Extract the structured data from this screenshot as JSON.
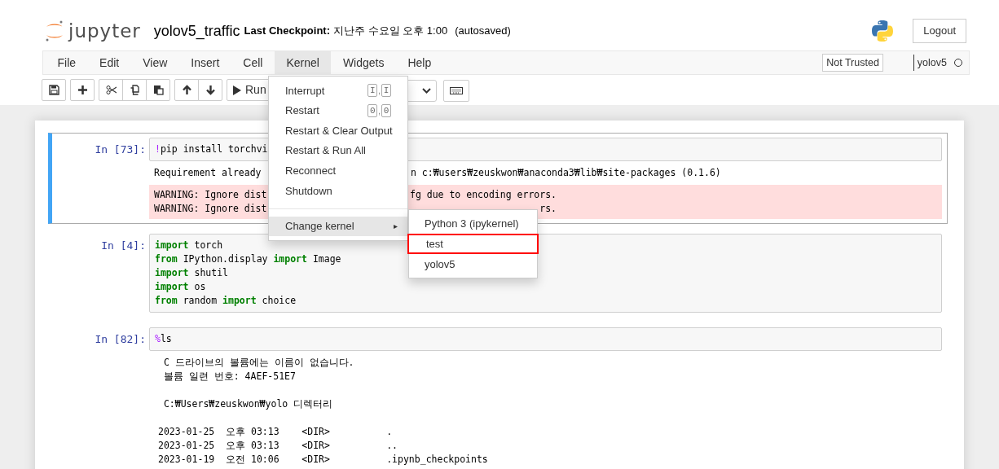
{
  "header": {
    "logo_text": "jupyter",
    "notebook_name": "yolov5_traffic",
    "checkpoint_label": "Last Checkpoint:",
    "checkpoint_time": "지난주 수요일 오후 1:00",
    "autosave": "(autosaved)",
    "logout": "Logout"
  },
  "menubar": {
    "items": [
      {
        "label": "File",
        "selected": false
      },
      {
        "label": "Edit",
        "selected": false
      },
      {
        "label": "View",
        "selected": false
      },
      {
        "label": "Insert",
        "selected": false
      },
      {
        "label": "Cell",
        "selected": false
      },
      {
        "label": "Kernel",
        "selected": true
      },
      {
        "label": "Widgets",
        "selected": false
      },
      {
        "label": "Help",
        "selected": false
      }
    ],
    "trust": "Not Trusted",
    "kernel_name": "yolov5"
  },
  "toolbar": {
    "groups": [
      [
        {
          "kind": "save"
        }
      ],
      [
        {
          "kind": "add"
        }
      ],
      [
        {
          "kind": "cut"
        },
        {
          "kind": "copy"
        },
        {
          "kind": "paste"
        }
      ],
      [
        {
          "kind": "up"
        },
        {
          "kind": "down"
        }
      ],
      [
        {
          "kind": "run"
        }
      ]
    ],
    "run_label": "Run"
  },
  "kernel_menu": {
    "items": [
      {
        "kind": "item",
        "label": "Interrupt",
        "shortcut": {
          "keys": [
            "I",
            "I"
          ],
          "separator": ","
        },
        "selected": false
      },
      {
        "kind": "item",
        "label": "Restart",
        "shortcut": {
          "keys": [
            "0",
            "0"
          ],
          "separator": ","
        },
        "selected": false
      },
      {
        "kind": "item",
        "label": "Restart & Clear Output",
        "selected": false
      },
      {
        "kind": "item",
        "label": "Restart & Run All",
        "selected": false
      },
      {
        "kind": "item",
        "label": "Reconnect",
        "selected": false
      },
      {
        "kind": "item",
        "label": "Shutdown",
        "selected": false
      },
      {
        "kind": "divider"
      },
      {
        "kind": "submenu",
        "label": "Change kernel",
        "arrow": "▸",
        "selected": true
      }
    ],
    "submenu": [
      {
        "label": "Python 3 (ipykernel)",
        "outlined": false
      },
      {
        "label": "test",
        "outlined": true
      },
      {
        "label": "yolov5",
        "outlined": false
      }
    ]
  },
  "cells": [
    {
      "prompt": "In [73]:",
      "selected": true,
      "input": [
        [
          {
            "kind": "magic",
            "t": "!"
          },
          {
            "kind": "plain",
            "t": "pip install torchvi"
          }
        ]
      ],
      "outputs": [
        {
          "kind": "stream",
          "lines": [
            {
              "left": "Requirement already",
              "right": "n c:₩users₩zeuskwon₩anaconda3₩lib₩site-packages (0.1.6)"
            }
          ]
        },
        {
          "kind": "stderr",
          "lines": [
            {
              "left": "WARNING: Ignore dist",
              "right": "fg due to encoding errors."
            },
            {
              "left": "WARNING: Ignore dist",
              "right": "rs."
            }
          ]
        }
      ]
    },
    {
      "prompt": "In [4]:",
      "selected": false,
      "input": [
        [
          {
            "kind": "keyword",
            "t": "import"
          },
          {
            "kind": "plain",
            "t": " torch"
          }
        ],
        [
          {
            "kind": "keyword",
            "t": "from"
          },
          {
            "kind": "plain",
            "t": " IPython.display "
          },
          {
            "kind": "keyword",
            "t": "import"
          },
          {
            "kind": "plain",
            "t": " Image"
          }
        ],
        [
          {
            "kind": "keyword",
            "t": "import"
          },
          {
            "kind": "plain",
            "t": " shutil"
          }
        ],
        [
          {
            "kind": "keyword",
            "t": "import"
          },
          {
            "kind": "plain",
            "t": " os"
          }
        ],
        [
          {
            "kind": "keyword",
            "t": "from"
          },
          {
            "kind": "plain",
            "t": " random "
          },
          {
            "kind": "keyword",
            "t": "import"
          },
          {
            "kind": "plain",
            "t": " choice"
          }
        ]
      ]
    },
    {
      "prompt": "In [82]:",
      "selected": false,
      "input": [
        [
          {
            "kind": "magic",
            "t": "%"
          },
          {
            "kind": "plain",
            "t": "ls"
          }
        ]
      ],
      "outputs": [
        {
          "kind": "text",
          "paragraphs": [
            [
              " C 드라이브의 볼륨에는 이름이 없습니다.",
              " 볼륨 일련 번호: 4AEF-51E7"
            ],
            [
              " C:₩Users₩zeuskwon₩yolo 디렉터리"
            ],
            [
              "2023-01-25  오후 03:13    <DIR>          .",
              "2023-01-25  오후 03:13    <DIR>          ..",
              "2023-01-19  오전 10:06    <DIR>          .ipynb_checkpoints"
            ]
          ]
        }
      ]
    }
  ]
}
